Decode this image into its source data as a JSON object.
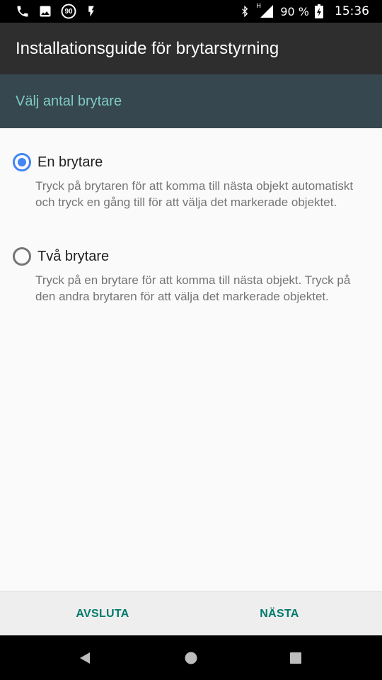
{
  "status_bar": {
    "icons": [
      "phone-icon",
      "image-icon",
      "speed-90-icon",
      "flash-icon",
      "bluetooth-icon",
      "signal-icon",
      "battery-icon"
    ],
    "speed_badge": "90",
    "network_type": "H",
    "battery": "90 %",
    "time": "15:36"
  },
  "toolbar": {
    "title": "Installationsguide för brytarstyrning"
  },
  "subheader": {
    "title": "Välj antal brytare"
  },
  "options": [
    {
      "label": "En brytare",
      "selected": true,
      "description": "Tryck på brytaren för att komma till nästa objekt automatiskt och tryck en gång till för att välja det markerade objektet."
    },
    {
      "label": "Två brytare",
      "selected": false,
      "description": "Tryck på en brytare för att komma till nästa objekt. Tryck på den andra brytaren för att välja det markerade objektet."
    }
  ],
  "buttons": {
    "finish": "AVSLUTA",
    "next": "NÄSTA"
  },
  "nav_bar": {
    "icons": [
      "back-icon",
      "home-icon",
      "recents-icon"
    ]
  },
  "colors": {
    "toolbar": "#2e2e2e",
    "subheader": "#36474f",
    "subheader_text": "#80cbc4",
    "radio_checked": "#4285f4",
    "button_text": "#00796b"
  }
}
